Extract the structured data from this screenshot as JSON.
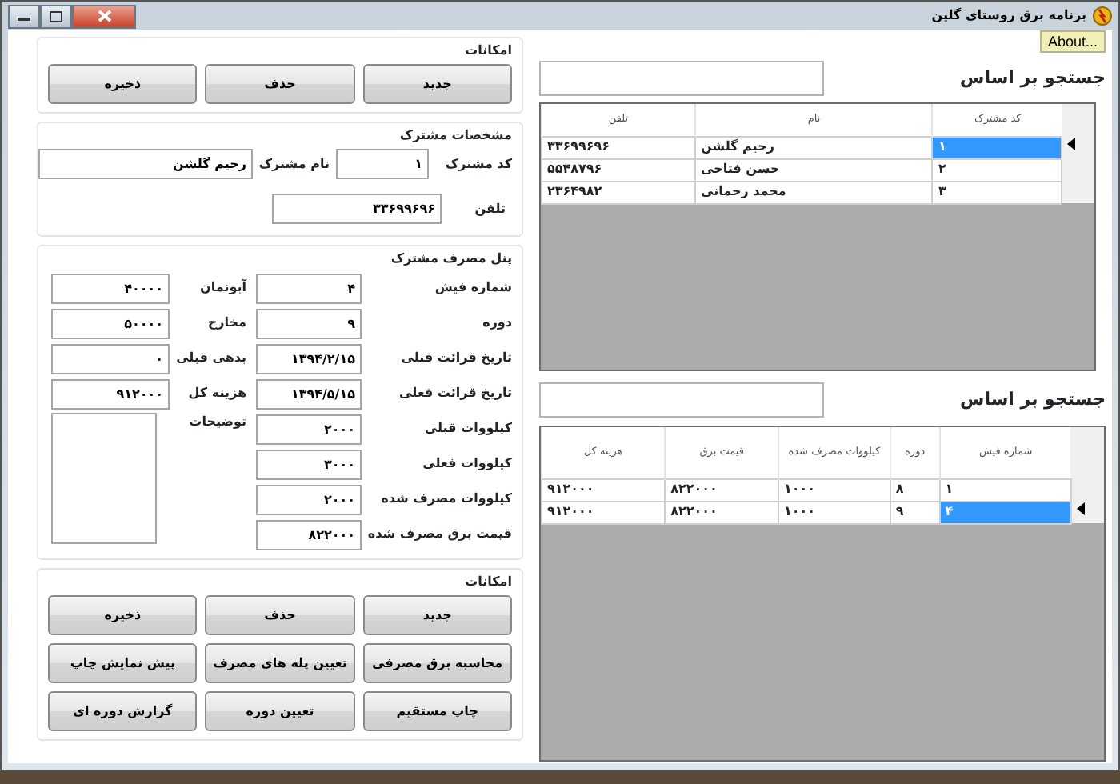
{
  "window": {
    "title": "برنامه برق روستای گلین"
  },
  "about_button": "About...",
  "subscriber_actions": {
    "title": "امکانات",
    "buttons": [
      "جدید",
      "حذف",
      "ذخیره"
    ]
  },
  "subscriber_details": {
    "title": "مشخصات مشترک",
    "fields": [
      {
        "label": "کد مشترک",
        "value": "۱"
      },
      {
        "label": "نام مشترک",
        "value": "رحیم گلشن"
      },
      {
        "label": "تلفن",
        "value": "۳۳۶۹۹۶۹۶"
      }
    ]
  },
  "consumption_panel": {
    "title": "پنل مصرف مشترک",
    "fields": [
      {
        "label": "شماره فیش",
        "value": "۴"
      },
      {
        "label": "دوره",
        "value": "۹"
      },
      {
        "label": "تاریخ قرائت قبلی",
        "value": "۱۳۹۴/۲/۱۵"
      },
      {
        "label": "تاریخ قرائت فعلی",
        "value": "۱۳۹۴/۵/۱۵"
      },
      {
        "label": "کیلووات قبلی",
        "value": "۲۰۰۰"
      },
      {
        "label": "کیلووات فعلی",
        "value": "۳۰۰۰"
      },
      {
        "label": "کیلووات مصرف شده",
        "value": "۲۰۰۰"
      },
      {
        "label": "قیمت برق مصرف شده",
        "value": "۸۲۲۰۰۰"
      }
    ],
    "costs": [
      {
        "label": "آبونمان",
        "value": "۴۰۰۰۰"
      },
      {
        "label": "مخارج",
        "value": "۵۰۰۰۰"
      },
      {
        "label": "بدهی قبلی",
        "value": "۰"
      },
      {
        "label": "هزینه کل",
        "value": "۹۱۲۰۰۰"
      }
    ],
    "notes_label": "توضیحات"
  },
  "bill_actions": {
    "title": "امکانات",
    "buttons": [
      "جدید",
      "حذف",
      "ذخیره",
      "محاسبه برق مصرفی",
      "تعیین پله های مصرف",
      "پیش نمایش چاپ",
      "چاپ مستقیم",
      "تعیین دوره",
      "گزارش  دوره ای"
    ]
  },
  "subscriber_search": {
    "label": "جستجو بر اساس"
  },
  "subscribers_table": {
    "columns": [
      "کد مشترک",
      "نام",
      "تلفن"
    ],
    "rows": [
      {
        "cells": [
          "۱",
          "رحیم گلشن",
          "۳۳۶۹۹۶۹۶"
        ],
        "selected": true
      },
      {
        "cells": [
          "۲",
          "حسن فتاحی",
          "۵۵۴۸۷۹۶"
        ],
        "selected": false
      },
      {
        "cells": [
          "۳",
          "محمد رحمانی",
          "۲۳۶۴۹۸۲"
        ],
        "selected": false
      }
    ]
  },
  "bills_search": {
    "label": "جستجو بر اساس"
  },
  "bills_table": {
    "columns": [
      "شماره فیش",
      "دوره",
      "کیلووات مصرف شده",
      "قیمت برق",
      "هزینه کل"
    ],
    "rows": [
      {
        "cells": [
          "۱",
          "۸",
          "۱۰۰۰",
          "۸۲۲۰۰۰",
          "۹۱۲۰۰۰"
        ],
        "selected": false
      },
      {
        "cells": [
          "۴",
          "۹",
          "۱۰۰۰",
          "۸۲۲۰۰۰",
          "۹۱۲۰۰۰"
        ],
        "selected": true
      }
    ]
  }
}
